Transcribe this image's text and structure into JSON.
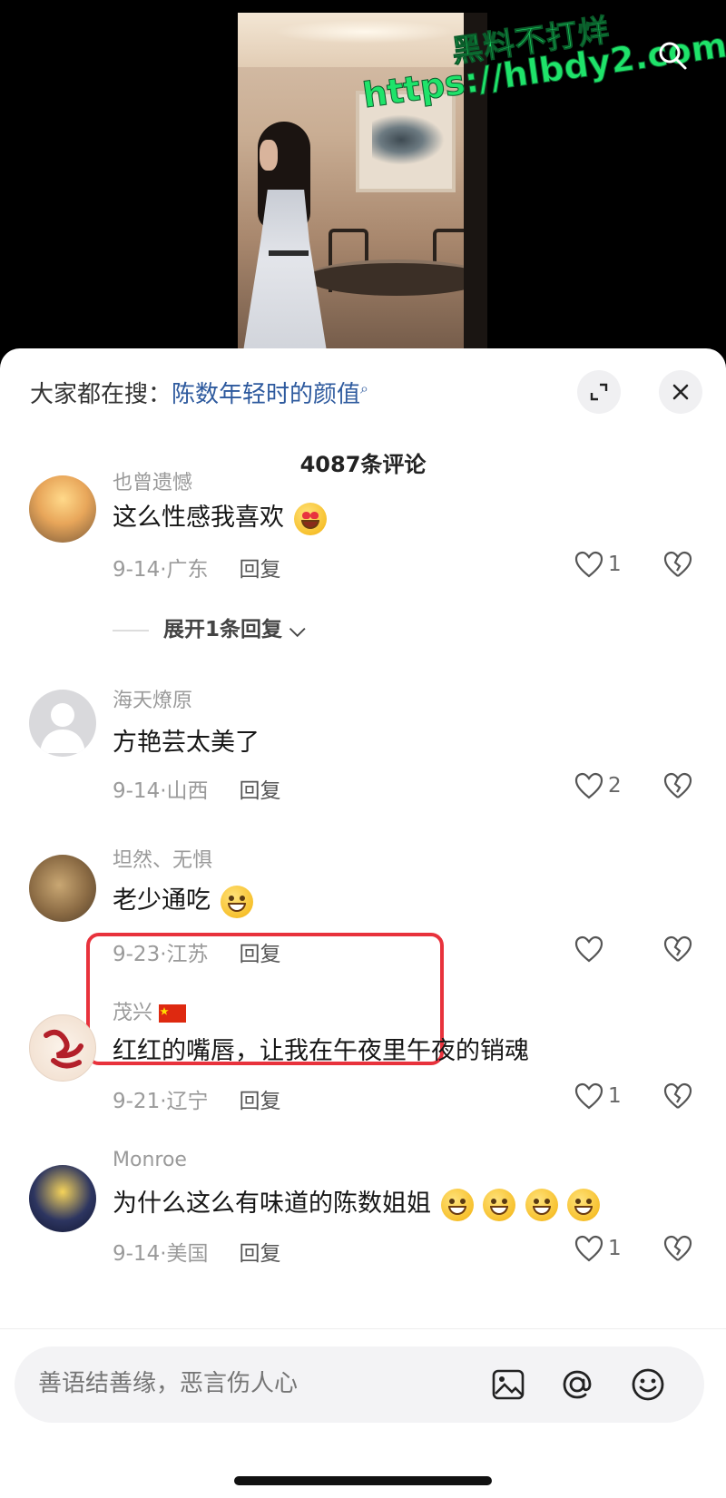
{
  "watermark": {
    "line1": "黑料不打烊",
    "line2": "https://hlbdy2.com"
  },
  "search_hint": {
    "prefix": "大家都在搜：",
    "query": "陈数年轻时的颜值",
    "icon": "search-icon"
  },
  "comment_count": "4087条评论",
  "comments": [
    {
      "username": "也曾遗憾",
      "content": "这么性感我喜欢",
      "emoji": "heart-eyes",
      "date": "9-14·广东",
      "reply": "回复",
      "likes": "1"
    },
    {
      "username": "海天燎原",
      "content": "方艳芸太美了",
      "emoji": "",
      "date": "9-14·山西",
      "reply": "回复",
      "likes": "2"
    },
    {
      "username": "坦然、无惧",
      "content": "老少通吃",
      "emoji": "grin",
      "date": "9-23·江苏",
      "reply": "回复",
      "likes": ""
    },
    {
      "username": "茂兴",
      "flag": "china-flag-icon",
      "content": "红红的嘴唇，让我在午夜里午夜的销魂",
      "emoji": "",
      "date": "9-21·辽宁",
      "reply": "回复",
      "likes": "1"
    },
    {
      "username": "Monroe",
      "content": "为什么这么有味道的陈数姐姐",
      "emoji": "grin-x4",
      "date": "9-14·美国",
      "reply": "回复",
      "likes": "1"
    }
  ],
  "expand_replies": "展开1条回复",
  "input": {
    "placeholder": "善语结善缘，恶言伤人心"
  },
  "colors": {
    "highlight": "#e8323c",
    "watermark": "#1fe36a",
    "query": "#2e5a9e"
  }
}
